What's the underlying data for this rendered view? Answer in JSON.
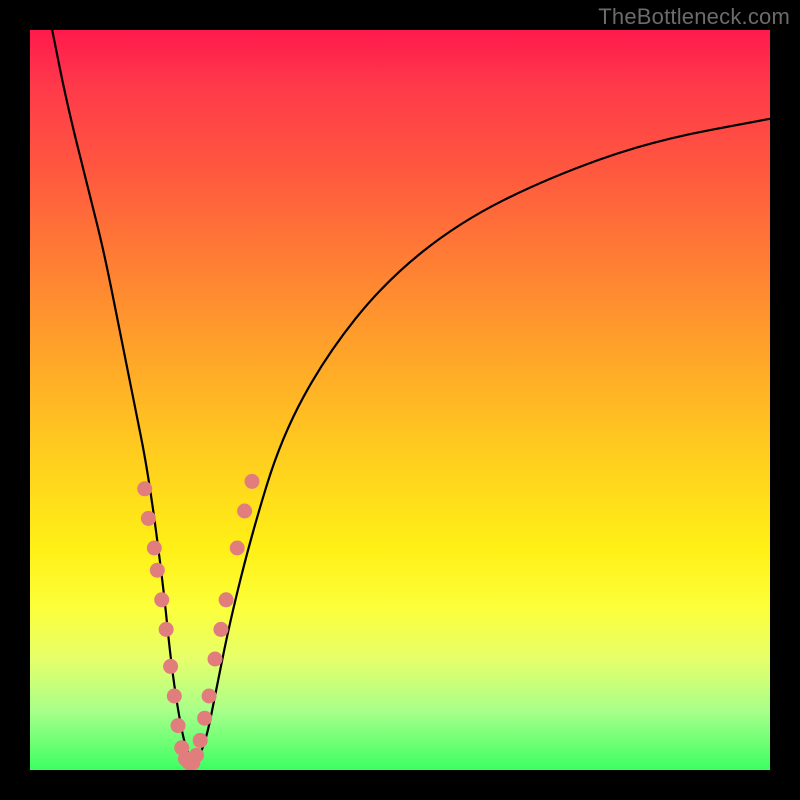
{
  "watermark": "TheBottleneck.com",
  "chart_data": {
    "type": "line",
    "title": "",
    "xlabel": "",
    "ylabel": "",
    "xlim": [
      0,
      100
    ],
    "ylim": [
      0,
      100
    ],
    "grid": false,
    "legend": false,
    "series": [
      {
        "name": "bottleneck-curve",
        "x": [
          3,
          5,
          8,
          10,
          12,
          14,
          16,
          18,
          19,
          20,
          21,
          22,
          23,
          24,
          25,
          27,
          30,
          34,
          40,
          48,
          58,
          70,
          84,
          100
        ],
        "y": [
          100,
          90,
          78,
          70,
          60,
          50,
          40,
          25,
          15,
          8,
          3,
          1,
          2,
          5,
          10,
          20,
          32,
          45,
          56,
          66,
          74,
          80,
          85,
          88
        ]
      }
    ],
    "markers": [
      {
        "name": "highlight-dots",
        "color": "#e17d7d",
        "points": [
          {
            "x": 15.5,
            "y": 38
          },
          {
            "x": 16.0,
            "y": 34
          },
          {
            "x": 16.8,
            "y": 30
          },
          {
            "x": 17.2,
            "y": 27
          },
          {
            "x": 17.8,
            "y": 23
          },
          {
            "x": 18.4,
            "y": 19
          },
          {
            "x": 19.0,
            "y": 14
          },
          {
            "x": 19.5,
            "y": 10
          },
          {
            "x": 20.0,
            "y": 6
          },
          {
            "x": 20.5,
            "y": 3
          },
          {
            "x": 21.0,
            "y": 1.5
          },
          {
            "x": 21.5,
            "y": 1
          },
          {
            "x": 22.0,
            "y": 1
          },
          {
            "x": 22.5,
            "y": 2
          },
          {
            "x": 23.0,
            "y": 4
          },
          {
            "x": 23.6,
            "y": 7
          },
          {
            "x": 24.2,
            "y": 10
          },
          {
            "x": 25.0,
            "y": 15
          },
          {
            "x": 25.8,
            "y": 19
          },
          {
            "x": 26.5,
            "y": 23
          },
          {
            "x": 28.0,
            "y": 30
          },
          {
            "x": 29.0,
            "y": 35
          },
          {
            "x": 30.0,
            "y": 39
          }
        ]
      }
    ]
  }
}
